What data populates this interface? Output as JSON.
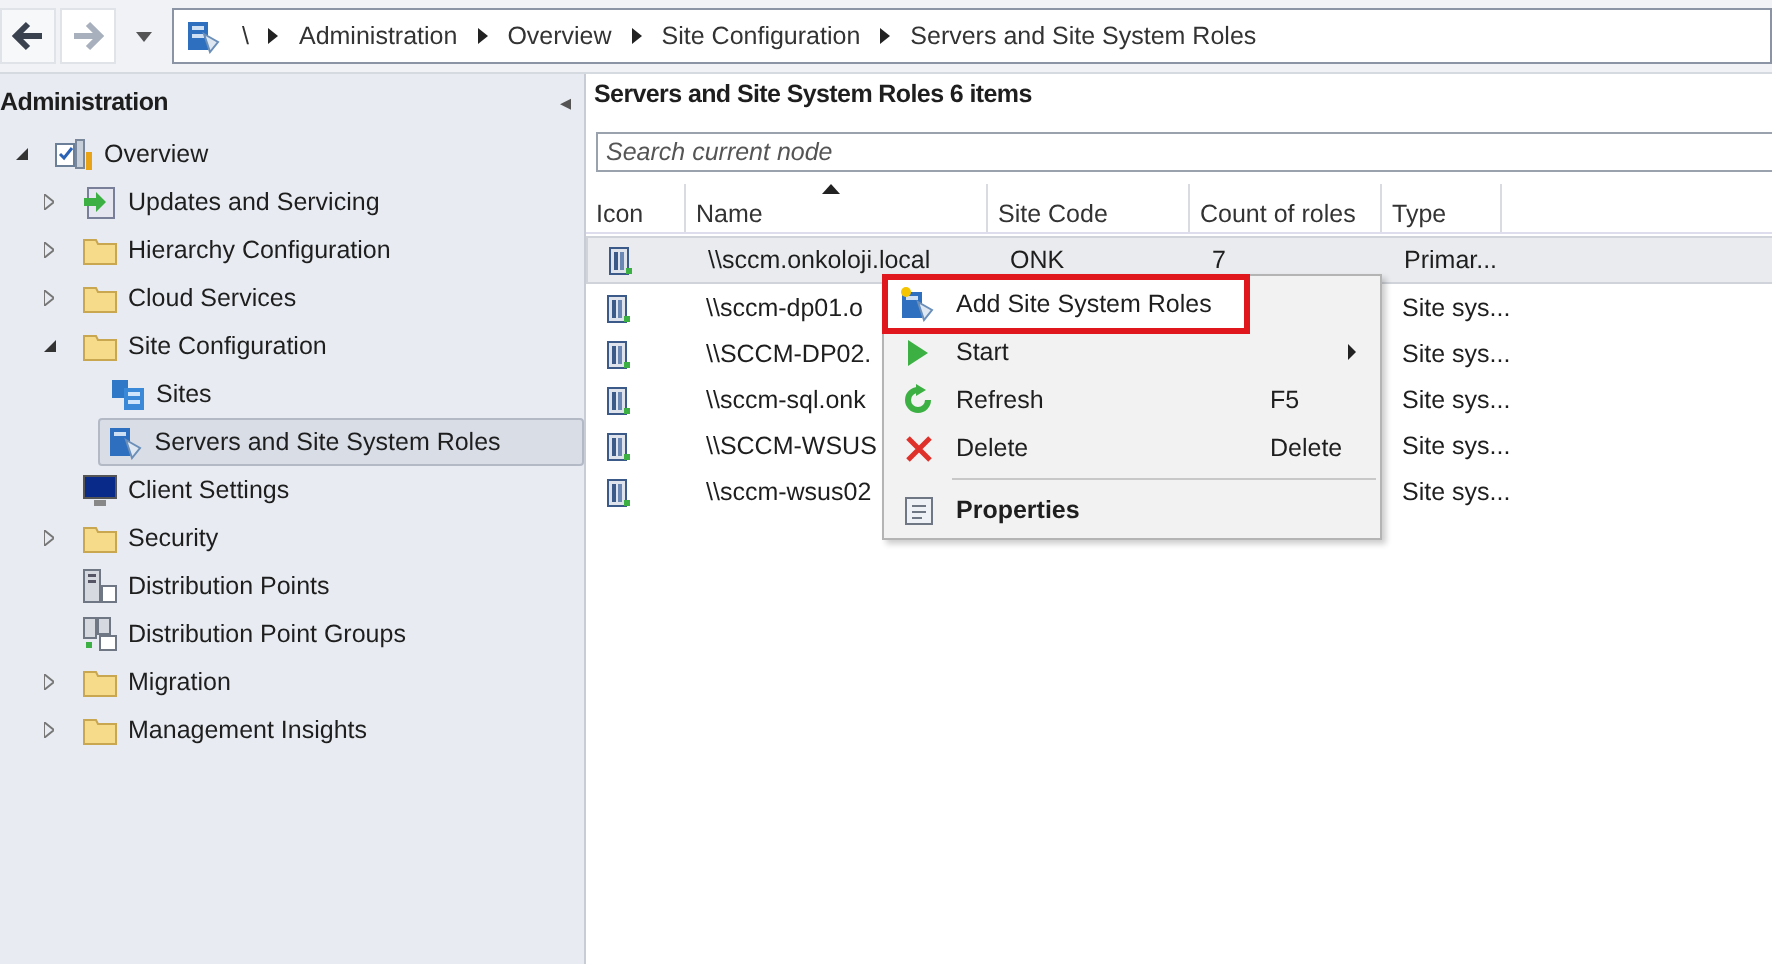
{
  "nav": {
    "back_enabled": true,
    "forward_enabled": false
  },
  "breadcrumb": [
    "\\",
    "Administration",
    "Overview",
    "Site Configuration",
    "Servers and Site System Roles"
  ],
  "sidebar": {
    "title": "Administration",
    "collapse": "◂",
    "tree": [
      {
        "label": "Overview",
        "kind": "overview",
        "expanded": true,
        "selected": false,
        "children": [
          {
            "label": "Updates and Servicing",
            "kind": "updates",
            "expanded": false,
            "selected": false
          },
          {
            "label": "Hierarchy Configuration",
            "kind": "folder",
            "expanded": false,
            "selected": false
          },
          {
            "label": "Cloud Services",
            "kind": "folder",
            "expanded": false,
            "selected": false
          },
          {
            "label": "Site Configuration",
            "kind": "folder",
            "expanded": true,
            "selected": false,
            "children": [
              {
                "label": "Sites",
                "kind": "sites",
                "selected": false
              },
              {
                "label": "Servers and Site System Roles",
                "kind": "servers",
                "selected": true
              }
            ]
          },
          {
            "label": "Client Settings",
            "kind": "monitor",
            "selected": false
          },
          {
            "label": "Security",
            "kind": "folder",
            "expanded": false,
            "selected": false
          },
          {
            "label": "Distribution Points",
            "kind": "dist",
            "selected": false
          },
          {
            "label": "Distribution Point Groups",
            "kind": "distgroup",
            "selected": false
          },
          {
            "label": "Migration",
            "kind": "folder",
            "expanded": false,
            "selected": false
          },
          {
            "label": "Management Insights",
            "kind": "folder",
            "expanded": false,
            "selected": false
          }
        ]
      }
    ]
  },
  "main": {
    "title": "Servers and Site System Roles",
    "count": "6 items",
    "search": {
      "placeholder": "Search current node"
    },
    "table": {
      "columns": [
        {
          "label": "Icon",
          "sorted": false
        },
        {
          "label": "Name",
          "sorted": true
        },
        {
          "label": "Site Code",
          "sorted": false
        },
        {
          "label": "Count of roles",
          "sorted": false
        },
        {
          "label": "Type",
          "sorted": false
        }
      ],
      "rows": [
        {
          "name": "\\\\sccm.onkoloji.local",
          "site_code": "ONK",
          "count": "7",
          "type": "Primar...",
          "selected": true
        },
        {
          "name": "\\\\sccm-dp01.o",
          "type": "Site sys...",
          "selected": false
        },
        {
          "name": "\\\\SCCM-DP02.",
          "type": "Site sys...",
          "selected": false
        },
        {
          "name": "\\\\sccm-sql.onk",
          "type": "Site sys...",
          "selected": false
        },
        {
          "name": "\\\\SCCM-WSUS",
          "type": "Site sys...",
          "selected": false
        },
        {
          "name": "\\\\sccm-wsus02",
          "type": "Site sys...",
          "selected": false
        }
      ]
    }
  },
  "context_menu": {
    "items": [
      {
        "kind": "add-roles",
        "label": "Add Site System Roles",
        "highlighted": true,
        "bold": false,
        "submenu": false
      },
      {
        "kind": "play",
        "label": "Start",
        "submenu": true,
        "highlighted": false,
        "bold": false
      },
      {
        "kind": "refresh",
        "label": "Refresh",
        "shortcut": "F5",
        "highlighted": false,
        "bold": false,
        "submenu": false
      },
      {
        "kind": "delete",
        "label": "Delete",
        "shortcut": "Delete",
        "highlighted": false,
        "bold": false,
        "submenu": false
      },
      {
        "kind": "separator"
      },
      {
        "kind": "properties",
        "label": "Properties",
        "highlighted": false,
        "bold": true,
        "submenu": false
      }
    ]
  }
}
